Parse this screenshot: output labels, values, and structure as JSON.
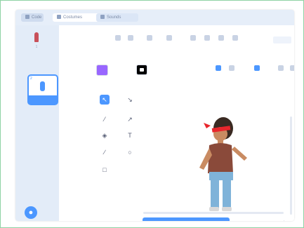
{
  "tabs": [
    {
      "label": "Code",
      "icon": "code-icon"
    },
    {
      "label": "Costumes",
      "icon": "costume-brush-icon"
    },
    {
      "label": "Sounds",
      "icon": "speaker-icon"
    }
  ],
  "costumes": [
    {
      "number": "1",
      "name": "",
      "icon": "person-costume-icon"
    },
    {
      "number": "2",
      "name": "",
      "icon": "person-costume-icon"
    }
  ],
  "toolbar": {
    "costume_name": "",
    "fill_label": "",
    "outline_label": "",
    "outline_width": "",
    "mode_button": ""
  },
  "tools": [
    {
      "name": "select",
      "icon": "arrow-pointer-icon",
      "glyph": "↖"
    },
    {
      "name": "reshape",
      "icon": "reshape-icon",
      "glyph": "↘"
    },
    {
      "name": "brush",
      "icon": "brush-icon",
      "glyph": "⁄"
    },
    {
      "name": "eraser",
      "icon": "eraser-icon",
      "glyph": "↗"
    },
    {
      "name": "fill",
      "icon": "bucket-icon",
      "glyph": "◈"
    },
    {
      "name": "text",
      "icon": "text-icon",
      "glyph": "T"
    },
    {
      "name": "line",
      "icon": "line-icon",
      "glyph": "∕"
    },
    {
      "name": "circle",
      "icon": "circle-icon",
      "glyph": "○"
    },
    {
      "name": "rectangle",
      "icon": "rectangle-icon",
      "glyph": "□"
    }
  ],
  "canvas": {
    "convert_button": "",
    "zoom": ""
  },
  "colors": {
    "accent": "#4c97ff",
    "fill": "#9966ff",
    "outline": "#000000",
    "frame_border": "#8fd3a4"
  }
}
